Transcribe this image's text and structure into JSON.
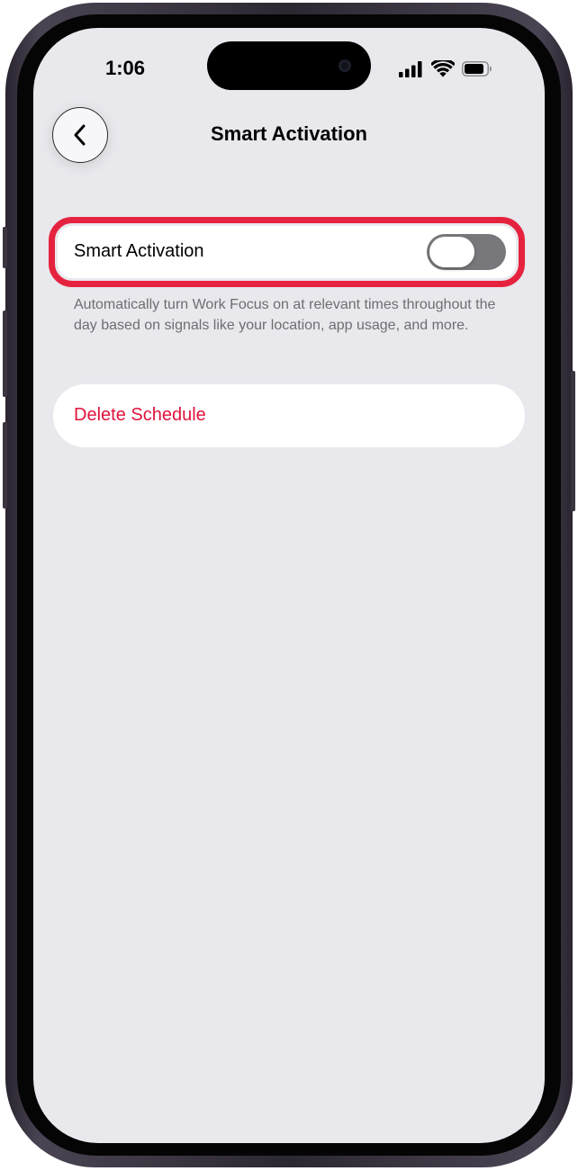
{
  "status_bar": {
    "time": "1:06",
    "icons": [
      "cellular-signal-icon",
      "wifi-icon",
      "battery-icon"
    ]
  },
  "nav": {
    "back_icon": "chevron-left-icon",
    "title": "Smart Activation"
  },
  "smart_activation": {
    "label": "Smart Activation",
    "toggle_on": false,
    "footnote": "Automatically turn Work Focus on at relevant times throughout the day based on signals like your location, app usage, and more."
  },
  "delete_schedule": {
    "label": "Delete Schedule"
  },
  "colors": {
    "background": "#e9e8ed",
    "highlight": "#e5233f",
    "destructive": "#e0133c",
    "toggle_off": "#78787c"
  }
}
